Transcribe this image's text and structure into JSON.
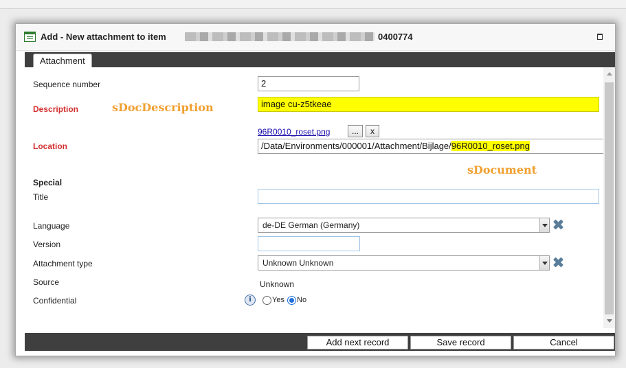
{
  "window": {
    "title": "Add - New attachment to item",
    "item_id": "0400774"
  },
  "tabs": [
    {
      "label": "Attachment"
    }
  ],
  "form": {
    "sequence_label": "Sequence number",
    "sequence_value": "2",
    "description_label": "Description",
    "description_value": "image cu-z5tkeae",
    "location_label": "Location",
    "location_link": "96R0010_roset.png",
    "browse_label": "...",
    "clear_label": "x",
    "location_path_prefix": "/Data/Environments/000001/Attachment/Bijlage/",
    "location_path_file": "96R0010_roset.png",
    "special_heading": "Special",
    "title_label": "Title",
    "title_value": "",
    "language_label": "Language",
    "language_value": "de-DE German (Germany)",
    "version_label": "Version",
    "version_value": "",
    "attachment_type_label": "Attachment type",
    "attachment_type_value": "Unknown Unknown",
    "source_label": "Source",
    "source_value": "Unknown",
    "confidential_label": "Confidential",
    "confidential_yes": "Yes",
    "confidential_no": "No",
    "confidential_selected": "No"
  },
  "annotations": {
    "description": "sDocDescription",
    "document": "sDocument"
  },
  "footer": {
    "add_next": "Add next record",
    "save": "Save record",
    "cancel": "Cancel"
  },
  "colors": {
    "required_label": "#d32f2f",
    "highlight": "#ffff00",
    "annotation": "#f0a030",
    "bar": "#3f3f3f"
  }
}
